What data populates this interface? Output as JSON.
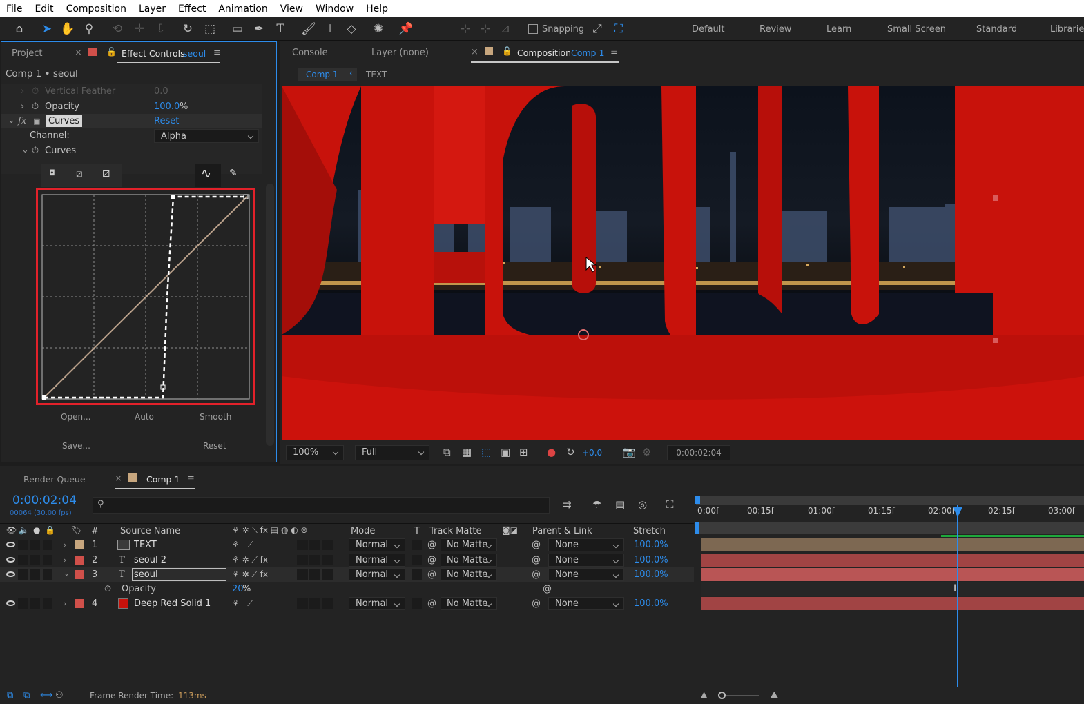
{
  "menu": [
    "File",
    "Edit",
    "Composition",
    "Layer",
    "Effect",
    "Animation",
    "View",
    "Window",
    "Help"
  ],
  "toolbar": {
    "snapping_label": "Snapping",
    "workspaces": [
      "Default",
      "Review",
      "Learn",
      "Small Screen",
      "Standard",
      "Libraries"
    ]
  },
  "left_panel": {
    "tab_project": "Project",
    "tab_effect_controls": "Effect Controls",
    "tab_effect_controls_layer": "seoul",
    "breadcrumb": "Comp 1 • seoul",
    "vertical_feather_label": "Vertical Feather",
    "vertical_feather_value": "0.0",
    "opacity_label": "Opacity",
    "opacity_value": "100.0",
    "opacity_unit": "%",
    "fx_label": "fx",
    "curves_effect_name": "Curves",
    "reset_link": "Reset",
    "channel_label": "Channel:",
    "channel_value": "Alpha",
    "curves_prop_label": "Curves",
    "buttons": {
      "open": "Open...",
      "auto": "Auto",
      "smooth": "Smooth",
      "save": "Save...",
      "reset": "Reset"
    }
  },
  "comp_panel": {
    "tab_console": "Console",
    "tab_layer": "Layer (none)",
    "tab_composition": "Composition",
    "tab_composition_name": "Comp 1",
    "crumb_comp": "Comp 1",
    "crumb_text": "TEXT",
    "zoom": "100%",
    "resolution": "Full",
    "exposure": "+0.0",
    "timecode": "0:00:02:04"
  },
  "timeline": {
    "tab_render_queue": "Render Queue",
    "tab_comp": "Comp 1",
    "current_time": "0:00:02:04",
    "frame_info": "00064 (30.00 fps)",
    "columns": {
      "num": "#",
      "source": "Source Name",
      "mode": "Mode",
      "t": "T",
      "track_matte": "Track Matte",
      "parent": "Parent & Link",
      "stretch": "Stretch"
    },
    "ruler": [
      "0:00f",
      "00:15f",
      "01:00f",
      "01:15f",
      "02:00f",
      "02:15f",
      "03:00f"
    ],
    "layers": [
      {
        "num": "1",
        "name": "TEXT",
        "mode": "Normal",
        "matte": "No Matte",
        "parent": "None",
        "stretch": "100.0%",
        "label_color": "#c7a67e"
      },
      {
        "num": "2",
        "name": "seoul 2",
        "mode": "Normal",
        "matte": "No Matte",
        "parent": "None",
        "stretch": "100.0%",
        "label_color": "#d0504a"
      },
      {
        "num": "3",
        "name": "seoul",
        "mode": "Normal",
        "matte": "No Matte",
        "parent": "None",
        "stretch": "100.0%",
        "label_color": "#d0504a"
      },
      {
        "num": "4",
        "name": "Deep Red Solid 1",
        "mode": "Normal",
        "matte": "No Matte",
        "parent": "None",
        "stretch": "100.0%",
        "label_color": "#d0504a"
      }
    ],
    "sub_property": {
      "label": "Opacity",
      "value": "20",
      "unit": "%"
    },
    "frame_render_label": "Frame Render Time:",
    "frame_render_value": "113ms"
  }
}
